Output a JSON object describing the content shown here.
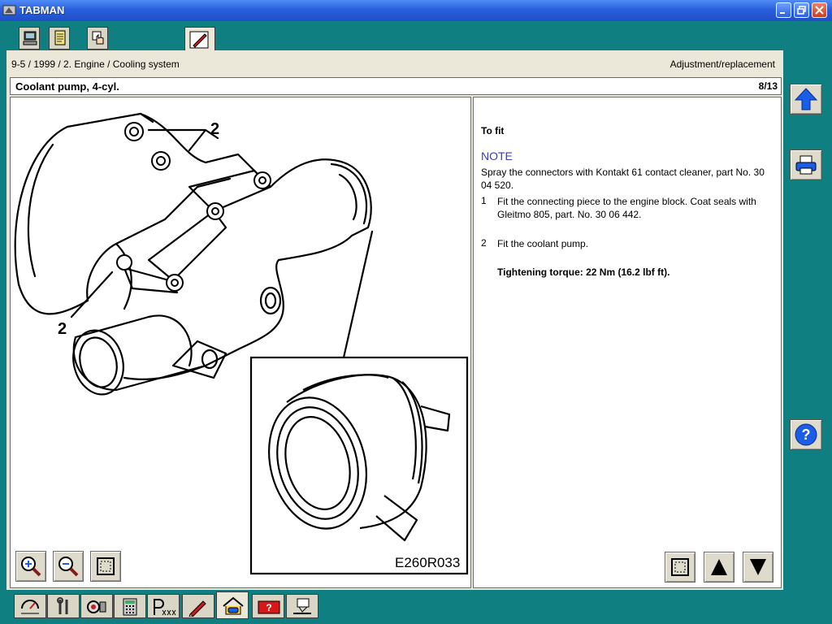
{
  "window": {
    "title": "TABMAN"
  },
  "header": {
    "breadcrumb": "9-5 / 1999 / 2. Engine / Cooling system",
    "section_type": "Adjustment/replacement",
    "page_title": "Coolant pump, 4-cyl.",
    "page_counter": "8/13"
  },
  "figure": {
    "label_top": "2",
    "label_left": "2",
    "code": "E260R033"
  },
  "content": {
    "to_fit": "To fit",
    "note_heading": "NOTE",
    "note_text": "Spray the connectors with Kontakt 61 contact cleaner, part No. 30 04 520.",
    "steps": [
      {
        "num": "1",
        "text": "Fit the connecting piece to the engine block. Coat seals with Gleitmo 805, part. No. 30 06 442."
      },
      {
        "num": "2",
        "text": "Fit the coolant pump."
      }
    ],
    "torque": "Tightening torque: 22 Nm (16.2 lbf ft)."
  },
  "icons": {
    "top_tabs": [
      "computer-icon",
      "document-icon",
      "hand-pointer-icon",
      "pencil-icon"
    ],
    "bottom_tabs": [
      "gauge-icon",
      "wrench-icon",
      "camera-icon",
      "calculator-icon",
      "part-number-icon",
      "pencil-icon",
      "car-home-icon",
      "alarm-icon",
      "hand-note-icon"
    ],
    "side": [
      "arrow-up-icon",
      "printer-icon",
      "help-icon"
    ]
  },
  "colors": {
    "desktop": "#0f7f82",
    "panel": "#ebe8da",
    "note": "#3a3ac8",
    "accent_blue": "#1a5ee8"
  }
}
